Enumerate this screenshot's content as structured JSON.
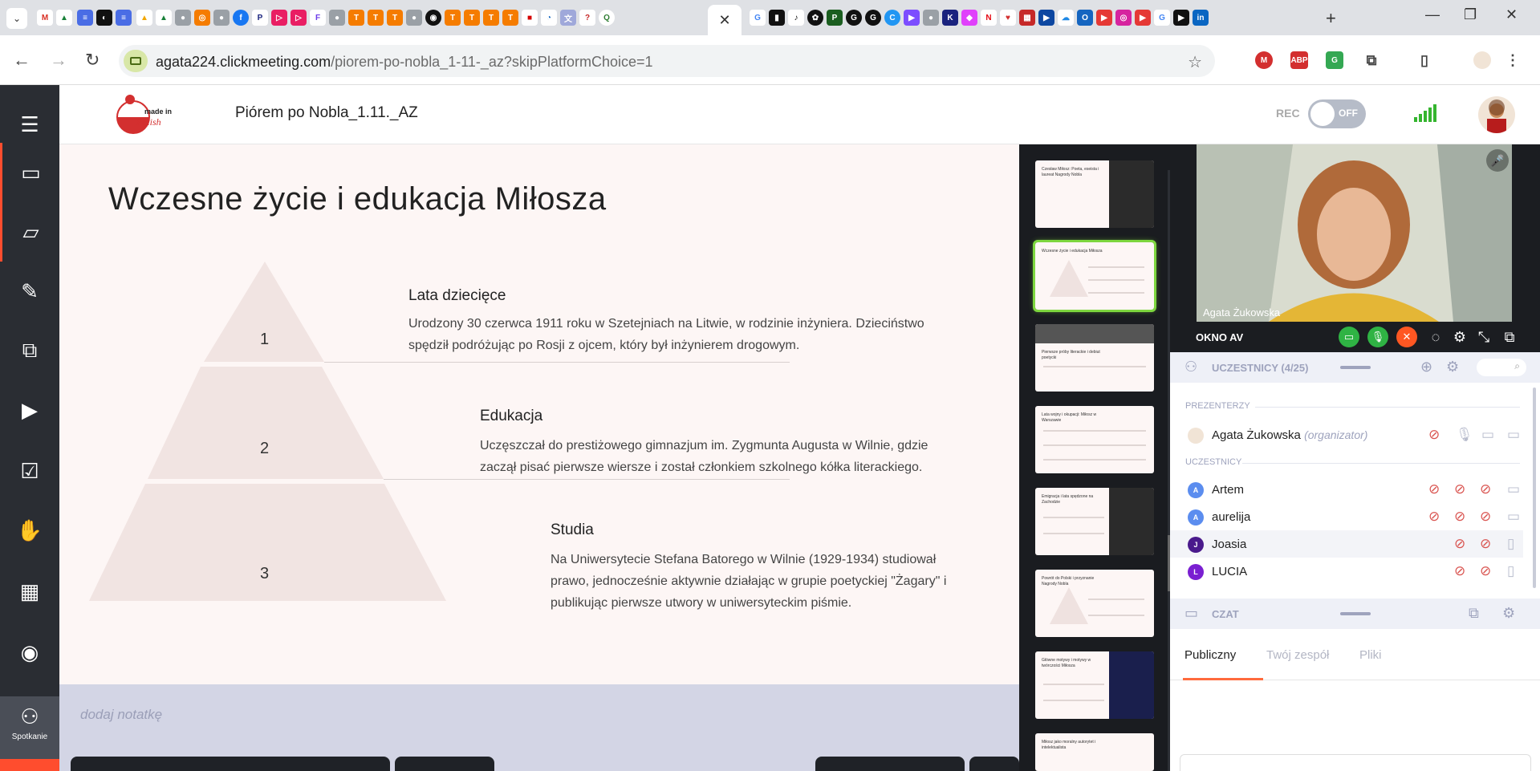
{
  "browser": {
    "active_tab_close": "✕",
    "url_host": "agata224.clickmeeting.com",
    "url_path": "/piorem-po-nobla_1-11-_az?skipPlatformChoice=1"
  },
  "app": {
    "meeting_title": "Piórem po Nobla_1.11._AZ",
    "logo_text": "made in Polish",
    "rec_label": "REC",
    "rec_state": "OFF",
    "sidebar_label": "Spotkanie"
  },
  "slide": {
    "title": "Wczesne życie i edukacja Miłosza",
    "sections": [
      {
        "num": "1",
        "title": "Lata dziecięce",
        "body_line1": "Urodzony 30 czerwca 1911 roku w Szetejniach na Litwie, w rodzinie inżyniera. Dzieciństwo",
        "body_line2": "spędził podróżując po Rosji z ojcem, który był inżynierem drogowym."
      },
      {
        "num": "2",
        "title": "Edukacja",
        "body_line1": "Uczęszczał do prestiżowego gimnazjum im. Zygmunta Augusta w Wilnie, gdzie",
        "body_line2": "zaczął pisać pierwsze wiersze i został członkiem szkolnego kółka literackiego."
      },
      {
        "num": "3",
        "title": "Studia",
        "body_line1": "Na Uniwersytecie Stefana Batorego w Wilnie (1929-1934) studiował",
        "body_line2": "prawo, jednocześnie aktywnie działając w grupie poetyckiej \"Żagary\" i",
        "body_line3": "publikując pierwsze utwory w uniwersyteckim piśmie."
      }
    ]
  },
  "notes": {
    "placeholder": "dodaj notatkę"
  },
  "thumbnails": [
    {
      "title": "Czesław Miłosz: Poeta, eseista i laureat Nagrody Nobla"
    },
    {
      "title": "Wczesne życie i edukacja Miłosza"
    },
    {
      "title": "Pierwsze próby literackie i debiut poetycki"
    },
    {
      "title": "Lata wojny i okupacji: Miłosz w Warszawie"
    },
    {
      "title": "Emigracja i lata spędzone na Zachodzie"
    },
    {
      "title": "Powrót do Polski i przyznanie Nagrody Nobla"
    },
    {
      "title": "Główne motywy i motywy w twórczości Miłosza"
    },
    {
      "title": "Miłosz jako moralny autorytet i intelektualista"
    }
  ],
  "video": {
    "name": "Agata Żukowska"
  },
  "av_bar": {
    "label": "OKNO AV"
  },
  "participants_section": {
    "header": "UCZESTNICY (4/25)",
    "presenters_label": "PREZENTERZY",
    "attendees_label": "UCZESTNICY",
    "presenter": {
      "name": "Agata Żukowska",
      "role": "(organizator)"
    },
    "attendees": [
      {
        "initial": "A",
        "name": "Artem",
        "color": "#5b8def"
      },
      {
        "initial": "A",
        "name": "aurelija",
        "color": "#5b8def"
      },
      {
        "initial": "J",
        "name": "Joasia",
        "color": "#4a1a8c"
      },
      {
        "initial": "L",
        "name": "LUCIA",
        "color": "#7a1fd1"
      }
    ]
  },
  "chat_section": {
    "header": "CZAT",
    "tabs": [
      "Publiczny",
      "Twój zespół",
      "Pliki"
    ]
  },
  "colors": {
    "sidebar": "#2a2d33",
    "accent": "#ff4d2e",
    "slide_bg": "#fdf6f5",
    "notes_bg": "#d3d5e5",
    "active_thumb": "#7dd63f"
  }
}
